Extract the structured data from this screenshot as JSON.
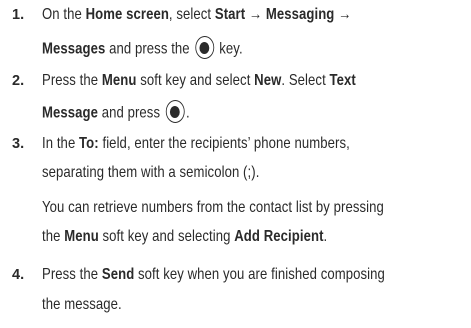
{
  "steps": [
    {
      "number": "1.",
      "lines": [
        [
          "On the ",
          "Home screen",
          ", select ",
          "Start",
          " → ",
          "Messaging",
          " →"
        ],
        [
          "Messages",
          " and press the ",
          " key."
        ]
      ]
    },
    {
      "number": "2.",
      "lines": [
        [
          "Press the ",
          "Menu",
          " soft key and select ",
          "New",
          ". Select ",
          "Text"
        ],
        [
          "Message",
          " and press ",
          "."
        ]
      ]
    },
    {
      "number": "3.",
      "lines": [
        [
          "In the ",
          "To:",
          " field, enter the recipients’ phone numbers,"
        ],
        [
          "separating them with a semicolon (;)."
        ]
      ],
      "note_lines": [
        [
          "You can retrieve numbers from the contact list by pressing"
        ],
        [
          "the ",
          "Menu",
          " soft key and selecting ",
          "Add Recipient",
          "."
        ]
      ]
    },
    {
      "number": "4.",
      "lines": [
        [
          "Press the ",
          "Send",
          " soft key when you are finished composing"
        ],
        [
          "the message."
        ]
      ]
    }
  ],
  "icons": {
    "select_key": "ok-select-key-icon"
  }
}
